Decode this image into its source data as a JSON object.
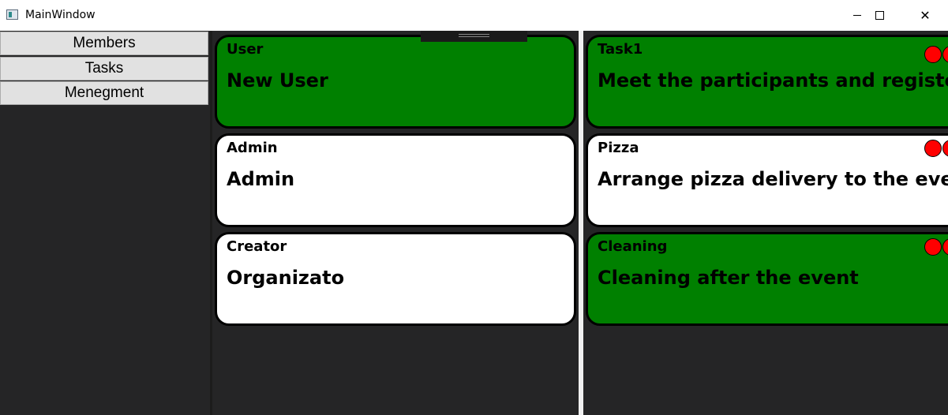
{
  "window": {
    "title": "MainWindow",
    "minimize_icon": "minimize-icon",
    "maximize_icon": "maximize-icon",
    "close_icon": "close-icon",
    "close_glyph": "✕"
  },
  "sidebar": {
    "items": [
      {
        "label": "Members"
      },
      {
        "label": "Tasks"
      },
      {
        "label": "Menegment"
      }
    ]
  },
  "members": [
    {
      "role": "User",
      "name": "New User",
      "color": "#008000"
    },
    {
      "role": "Admin",
      "name": "Admin",
      "color": "#ffffff"
    },
    {
      "role": "Creator",
      "name": "Organizato",
      "color": "#ffffff"
    }
  ],
  "tasks": [
    {
      "title": "Task1",
      "description": "Meet the participants and register",
      "color": "#008000"
    },
    {
      "title": "Pizza",
      "description": "Arrange pizza delivery to the event",
      "color": "#ffffff"
    },
    {
      "title": "Cleaning",
      "description": "Cleaning after the event",
      "color": "#008000"
    }
  ],
  "colors": {
    "accent_green": "#008000",
    "status_red": "#ff0000",
    "background": "#252526"
  }
}
